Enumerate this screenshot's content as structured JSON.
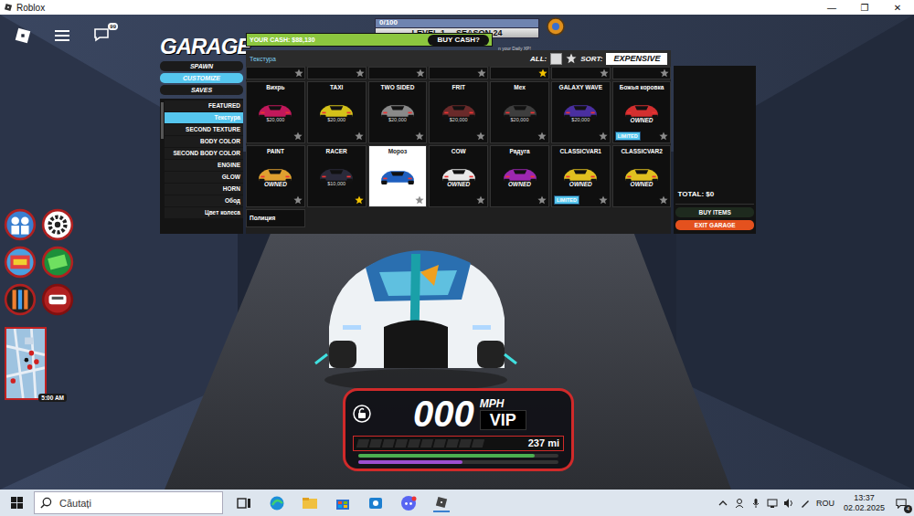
{
  "window": {
    "title": "Roblox",
    "controls": [
      "—",
      "❐",
      "✕"
    ]
  },
  "roblox_bar": {
    "chat_badge": "99"
  },
  "xp": {
    "reading": "0/100",
    "level": 0,
    "level_label": "LEVEL 1",
    "season": "SEASON 24"
  },
  "garage": {
    "title": "GARAGE",
    "cash": "YOUR CASH: $88,130",
    "buy_cash": "BUY CASH?",
    "daily_xp": "n your Daily XP!",
    "tabs": [
      {
        "label": "SPAWN",
        "selected": false
      },
      {
        "label": "CUSTOMIZE",
        "selected": true
      },
      {
        "label": "SAVES",
        "selected": false
      }
    ],
    "categories": [
      {
        "label": "FEATURED",
        "selected": false
      },
      {
        "label": "Текстура",
        "selected": true
      },
      {
        "label": "SECOND TEXTURE",
        "selected": false
      },
      {
        "label": "BODY COLOR",
        "selected": false
      },
      {
        "label": "SECOND BODY COLOR",
        "selected": false
      },
      {
        "label": "ENGINE",
        "selected": false
      },
      {
        "label": "GLOW",
        "selected": false
      },
      {
        "label": "HORN",
        "selected": false
      },
      {
        "label": "Обод",
        "selected": false
      },
      {
        "label": "Цвет колеса",
        "selected": false
      }
    ],
    "section": "Текстура",
    "all_label": "ALL:",
    "all_checked": false,
    "sort_label": "SORT:",
    "sort_value": "EXPENSIVE",
    "peek_top": [
      {
        "starred": false
      },
      {
        "starred": false
      },
      {
        "starred": false
      },
      {
        "starred": false
      },
      {
        "starred": true
      },
      {
        "starred": false
      },
      {
        "starred": false
      }
    ],
    "rows": [
      [
        {
          "name": "Вихрь",
          "tag": "$20,000",
          "owned": false,
          "limited": false,
          "starred": false,
          "selected": false,
          "color": "#c2185b"
        },
        {
          "name": "TAXI",
          "tag": "$20,000",
          "owned": false,
          "limited": false,
          "starred": false,
          "selected": false,
          "color": "#d4c21a"
        },
        {
          "name": "TWO SIDED",
          "tag": "$20,000",
          "owned": false,
          "limited": false,
          "starred": false,
          "selected": false,
          "color": "#8a8a8a"
        },
        {
          "name": "FRIT",
          "tag": "$20,000",
          "owned": false,
          "limited": false,
          "starred": false,
          "selected": false,
          "color": "#6a2a2a"
        },
        {
          "name": "Мех",
          "tag": "$20,000",
          "owned": false,
          "limited": false,
          "starred": false,
          "selected": false,
          "color": "#3e3e3e"
        },
        {
          "name": "GALAXY WAVE",
          "tag": "$20,000",
          "owned": false,
          "limited": false,
          "starred": false,
          "selected": false,
          "color": "#4a2fa0"
        },
        {
          "name": "Божья коровка",
          "tag": "OWNED",
          "owned": true,
          "limited": true,
          "starred": false,
          "selected": false,
          "color": "#d32f2f"
        }
      ],
      [
        {
          "name": "PAINT",
          "tag": "OWNED",
          "owned": true,
          "limited": false,
          "starred": false,
          "selected": false,
          "color": "#e0a030"
        },
        {
          "name": "RACER",
          "tag": "$10,000",
          "owned": false,
          "limited": false,
          "starred": true,
          "selected": false,
          "color": "#2a2a3a"
        },
        {
          "name": "Мороз",
          "owned": false,
          "limited": false,
          "starred": false,
          "selected": true,
          "color": "#1f5fbf"
        },
        {
          "name": "COW",
          "tag": "OWNED",
          "owned": true,
          "limited": false,
          "starred": false,
          "selected": false,
          "color": "#e8e8e8"
        },
        {
          "name": "Радуга",
          "tag": "OWNED",
          "owned": true,
          "limited": false,
          "starred": false,
          "selected": false,
          "color": "#9c27b0"
        },
        {
          "name": "CLASSICVAR1",
          "tag": "OWNED",
          "owned": true,
          "limited": true,
          "starred": false,
          "selected": false,
          "color": "#e0c020"
        },
        {
          "name": "CLASSICVAR2",
          "tag": "OWNED",
          "owned": true,
          "limited": false,
          "starred": false,
          "selected": false,
          "color": "#e0c020"
        }
      ]
    ],
    "limited_label": "LIMITED",
    "peek_bottom": [
      {
        "name": "Полиция"
      }
    ],
    "total": "TOTAL: $0",
    "buy_items": "BUY ITEMS",
    "exit": "EXIT GARAGE"
  },
  "speedometer": {
    "speed": "000",
    "unit": "MPH",
    "badge": "VIP",
    "distance": "237 mi",
    "locked": false,
    "boost_level": 0,
    "fuel_level": 0.88,
    "nitro_level": 0.52
  },
  "minimap": {
    "time": "5:00 AM"
  },
  "taskbar": {
    "search": "Căutați",
    "language": "ROU",
    "time": "13:37",
    "date": "02.02.2025",
    "notifications": "4"
  }
}
